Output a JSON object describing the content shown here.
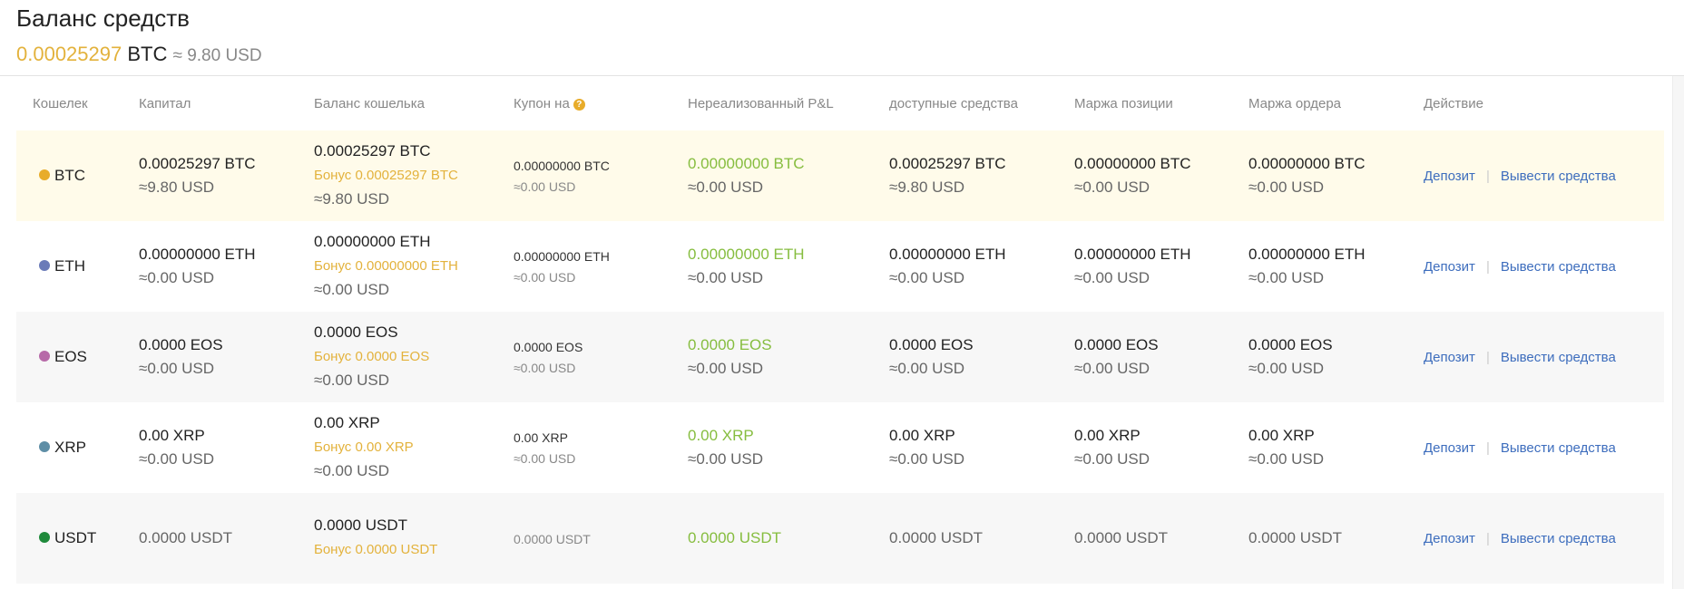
{
  "header": {
    "title": "Баланс средств",
    "total_amount": "0.00025297",
    "total_currency": "BTC",
    "total_usd": "≈ 9.80 USD"
  },
  "table": {
    "columns": {
      "wallet": "Кошелек",
      "capital": "Капитал",
      "wallet_balance": "Баланс кошелька",
      "coupon": "Купон на",
      "unrealized_pnl": "Нереализованный P&L",
      "available": "доступные средства",
      "position_margin": "Маржа позиции",
      "order_margin": "Маржа ордера",
      "action": "Действие"
    },
    "help_icon_glyph": "?",
    "rows": [
      {
        "wallet": "BTC",
        "dot_color": "#e8ac2a",
        "capital": "0.00025297 BTC",
        "capital_usd": "≈9.80 USD",
        "balance": "0.00025297 BTC",
        "bonus": "Бонус 0.00025297 BTC",
        "balance_usd": "≈9.80 USD",
        "coupon": "0.00000000 BTC",
        "coupon_usd": "≈0.00 USD",
        "pnl": "0.00000000 BTC",
        "pnl_usd": "≈0.00 USD",
        "available": "0.00025297 BTC",
        "available_usd": "≈9.80 USD",
        "position_margin": "0.00000000 BTC",
        "position_margin_usd": "≈0.00 USD",
        "order_margin": "0.00000000 BTC",
        "order_margin_usd": "≈0.00 USD",
        "deposit": "Депозит",
        "withdraw": "Вывести средства",
        "separator": "|"
      },
      {
        "wallet": "ETH",
        "dot_color": "#6b7bb8",
        "capital": "0.00000000 ETH",
        "capital_usd": "≈0.00 USD",
        "balance": "0.00000000 ETH",
        "bonus": "Бонус 0.00000000 ETH",
        "balance_usd": "≈0.00 USD",
        "coupon": "0.00000000 ETH",
        "coupon_usd": "≈0.00 USD",
        "pnl": "0.00000000 ETH",
        "pnl_usd": "≈0.00 USD",
        "available": "0.00000000 ETH",
        "available_usd": "≈0.00 USD",
        "position_margin": "0.00000000 ETH",
        "position_margin_usd": "≈0.00 USD",
        "order_margin": "0.00000000 ETH",
        "order_margin_usd": "≈0.00 USD",
        "deposit": "Депозит",
        "withdraw": "Вывести средства",
        "separator": "|"
      },
      {
        "wallet": "EOS",
        "dot_color": "#b76aa8",
        "capital": "0.0000 EOS",
        "capital_usd": "≈0.00 USD",
        "balance": "0.0000 EOS",
        "bonus": "Бонус 0.0000 EOS",
        "balance_usd": "≈0.00 USD",
        "coupon": "0.0000 EOS",
        "coupon_usd": "≈0.00 USD",
        "pnl": "0.0000 EOS",
        "pnl_usd": "≈0.00 USD",
        "available": "0.0000 EOS",
        "available_usd": "≈0.00 USD",
        "position_margin": "0.0000 EOS",
        "position_margin_usd": "≈0.00 USD",
        "order_margin": "0.0000 EOS",
        "order_margin_usd": "≈0.00 USD",
        "deposit": "Депозит",
        "withdraw": "Вывести средства",
        "separator": "|"
      },
      {
        "wallet": "XRP",
        "dot_color": "#5e8ea6",
        "capital": "0.00 XRP",
        "capital_usd": "≈0.00 USD",
        "balance": "0.00 XRP",
        "bonus": "Бонус 0.00 XRP",
        "balance_usd": "≈0.00 USD",
        "coupon": "0.00 XRP",
        "coupon_usd": "≈0.00 USD",
        "pnl": "0.00 XRP",
        "pnl_usd": "≈0.00 USD",
        "available": "0.00 XRP",
        "available_usd": "≈0.00 USD",
        "position_margin": "0.00 XRP",
        "position_margin_usd": "≈0.00 USD",
        "order_margin": "0.00 XRP",
        "order_margin_usd": "≈0.00 USD",
        "deposit": "Депозит",
        "withdraw": "Вывести средства",
        "separator": "|"
      },
      {
        "wallet": "USDT",
        "dot_color": "#1f8a3b",
        "capital": "0.0000 USDT",
        "balance": "0.0000 USDT",
        "bonus": "Бонус 0.0000 USDT",
        "coupon": "0.0000 USDT",
        "pnl": "0.0000 USDT",
        "available": "0.0000 USDT",
        "position_margin": "0.0000 USDT",
        "order_margin": "0.0000 USDT",
        "deposit": "Депозит",
        "withdraw": "Вывести средства",
        "separator": "|"
      }
    ]
  },
  "colors": {
    "accent_gold": "#e3b23c",
    "pnl_green": "#86bd3f",
    "link_blue": "#3d6dbd",
    "highlight_row": "#fffbea"
  }
}
